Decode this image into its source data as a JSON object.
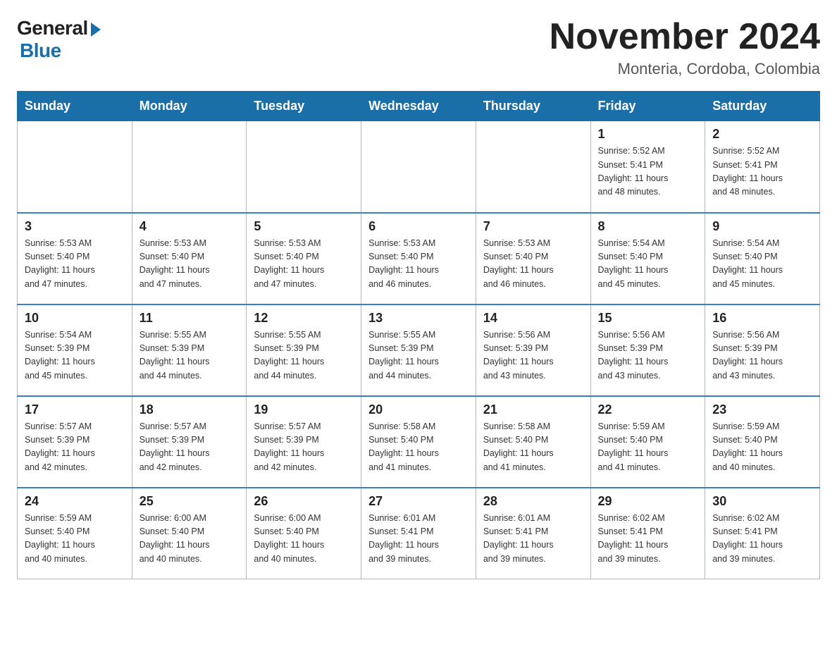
{
  "logo": {
    "general": "General",
    "blue": "Blue"
  },
  "title": "November 2024",
  "location": "Monteria, Cordoba, Colombia",
  "days_of_week": [
    "Sunday",
    "Monday",
    "Tuesday",
    "Wednesday",
    "Thursday",
    "Friday",
    "Saturday"
  ],
  "weeks": [
    [
      {
        "day": "",
        "info": ""
      },
      {
        "day": "",
        "info": ""
      },
      {
        "day": "",
        "info": ""
      },
      {
        "day": "",
        "info": ""
      },
      {
        "day": "",
        "info": ""
      },
      {
        "day": "1",
        "info": "Sunrise: 5:52 AM\nSunset: 5:41 PM\nDaylight: 11 hours\nand 48 minutes."
      },
      {
        "day": "2",
        "info": "Sunrise: 5:52 AM\nSunset: 5:41 PM\nDaylight: 11 hours\nand 48 minutes."
      }
    ],
    [
      {
        "day": "3",
        "info": "Sunrise: 5:53 AM\nSunset: 5:40 PM\nDaylight: 11 hours\nand 47 minutes."
      },
      {
        "day": "4",
        "info": "Sunrise: 5:53 AM\nSunset: 5:40 PM\nDaylight: 11 hours\nand 47 minutes."
      },
      {
        "day": "5",
        "info": "Sunrise: 5:53 AM\nSunset: 5:40 PM\nDaylight: 11 hours\nand 47 minutes."
      },
      {
        "day": "6",
        "info": "Sunrise: 5:53 AM\nSunset: 5:40 PM\nDaylight: 11 hours\nand 46 minutes."
      },
      {
        "day": "7",
        "info": "Sunrise: 5:53 AM\nSunset: 5:40 PM\nDaylight: 11 hours\nand 46 minutes."
      },
      {
        "day": "8",
        "info": "Sunrise: 5:54 AM\nSunset: 5:40 PM\nDaylight: 11 hours\nand 45 minutes."
      },
      {
        "day": "9",
        "info": "Sunrise: 5:54 AM\nSunset: 5:40 PM\nDaylight: 11 hours\nand 45 minutes."
      }
    ],
    [
      {
        "day": "10",
        "info": "Sunrise: 5:54 AM\nSunset: 5:39 PM\nDaylight: 11 hours\nand 45 minutes."
      },
      {
        "day": "11",
        "info": "Sunrise: 5:55 AM\nSunset: 5:39 PM\nDaylight: 11 hours\nand 44 minutes."
      },
      {
        "day": "12",
        "info": "Sunrise: 5:55 AM\nSunset: 5:39 PM\nDaylight: 11 hours\nand 44 minutes."
      },
      {
        "day": "13",
        "info": "Sunrise: 5:55 AM\nSunset: 5:39 PM\nDaylight: 11 hours\nand 44 minutes."
      },
      {
        "day": "14",
        "info": "Sunrise: 5:56 AM\nSunset: 5:39 PM\nDaylight: 11 hours\nand 43 minutes."
      },
      {
        "day": "15",
        "info": "Sunrise: 5:56 AM\nSunset: 5:39 PM\nDaylight: 11 hours\nand 43 minutes."
      },
      {
        "day": "16",
        "info": "Sunrise: 5:56 AM\nSunset: 5:39 PM\nDaylight: 11 hours\nand 43 minutes."
      }
    ],
    [
      {
        "day": "17",
        "info": "Sunrise: 5:57 AM\nSunset: 5:39 PM\nDaylight: 11 hours\nand 42 minutes."
      },
      {
        "day": "18",
        "info": "Sunrise: 5:57 AM\nSunset: 5:39 PM\nDaylight: 11 hours\nand 42 minutes."
      },
      {
        "day": "19",
        "info": "Sunrise: 5:57 AM\nSunset: 5:39 PM\nDaylight: 11 hours\nand 42 minutes."
      },
      {
        "day": "20",
        "info": "Sunrise: 5:58 AM\nSunset: 5:40 PM\nDaylight: 11 hours\nand 41 minutes."
      },
      {
        "day": "21",
        "info": "Sunrise: 5:58 AM\nSunset: 5:40 PM\nDaylight: 11 hours\nand 41 minutes."
      },
      {
        "day": "22",
        "info": "Sunrise: 5:59 AM\nSunset: 5:40 PM\nDaylight: 11 hours\nand 41 minutes."
      },
      {
        "day": "23",
        "info": "Sunrise: 5:59 AM\nSunset: 5:40 PM\nDaylight: 11 hours\nand 40 minutes."
      }
    ],
    [
      {
        "day": "24",
        "info": "Sunrise: 5:59 AM\nSunset: 5:40 PM\nDaylight: 11 hours\nand 40 minutes."
      },
      {
        "day": "25",
        "info": "Sunrise: 6:00 AM\nSunset: 5:40 PM\nDaylight: 11 hours\nand 40 minutes."
      },
      {
        "day": "26",
        "info": "Sunrise: 6:00 AM\nSunset: 5:40 PM\nDaylight: 11 hours\nand 40 minutes."
      },
      {
        "day": "27",
        "info": "Sunrise: 6:01 AM\nSunset: 5:41 PM\nDaylight: 11 hours\nand 39 minutes."
      },
      {
        "day": "28",
        "info": "Sunrise: 6:01 AM\nSunset: 5:41 PM\nDaylight: 11 hours\nand 39 minutes."
      },
      {
        "day": "29",
        "info": "Sunrise: 6:02 AM\nSunset: 5:41 PM\nDaylight: 11 hours\nand 39 minutes."
      },
      {
        "day": "30",
        "info": "Sunrise: 6:02 AM\nSunset: 5:41 PM\nDaylight: 11 hours\nand 39 minutes."
      }
    ]
  ]
}
